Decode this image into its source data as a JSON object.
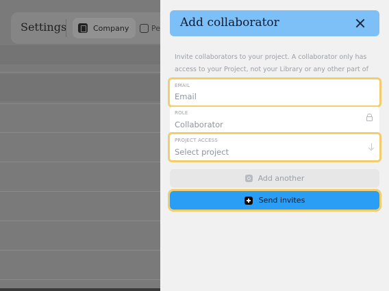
{
  "background": {
    "title": "Settings",
    "tabs": [
      {
        "label": "Company",
        "active": true
      },
      {
        "label": "Pe",
        "active": false
      }
    ]
  },
  "drawer": {
    "title": "Add collaborator",
    "description": "Invite collaborators to your project. A collaborator only has access to your Project, not your Library or any other part of your team.",
    "fields": {
      "email": {
        "label": "EMAIL",
        "placeholder": "Email",
        "value": ""
      },
      "role": {
        "label": "ROLE",
        "value": "Collaborator"
      },
      "project_access": {
        "label": "PROJECT ACCESS",
        "value": "Select project"
      }
    },
    "add_another_label": "Add another",
    "send_label": "Send invites"
  },
  "colors": {
    "header_accent": "#7dbff7",
    "primary_button": "#2a9df4",
    "highlight": "#f2cd6e"
  }
}
